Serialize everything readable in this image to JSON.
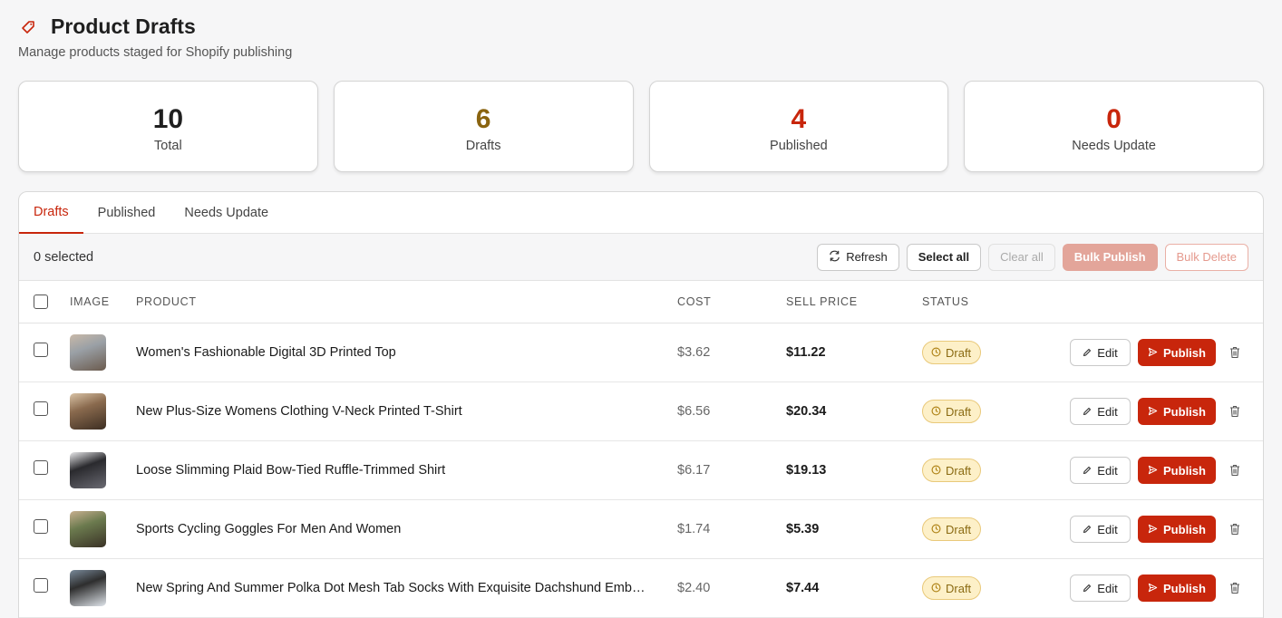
{
  "header": {
    "title": "Product Drafts",
    "subtitle": "Manage products staged for Shopify publishing",
    "icon": "tag-icon"
  },
  "stats": [
    {
      "value": "10",
      "label": "Total",
      "color": "#1f1f1f"
    },
    {
      "value": "6",
      "label": "Drafts",
      "color": "#8a6410"
    },
    {
      "value": "4",
      "label": "Published",
      "color": "#c8260c"
    },
    {
      "value": "0",
      "label": "Needs Update",
      "color": "#c8260c"
    }
  ],
  "tabs": [
    {
      "label": "Drafts",
      "active": true
    },
    {
      "label": "Published",
      "active": false
    },
    {
      "label": "Needs Update",
      "active": false
    }
  ],
  "toolbar": {
    "selected": "0 selected",
    "refresh": "Refresh",
    "select_all": "Select all",
    "clear_all": "Clear all",
    "bulk_publish": "Bulk Publish",
    "bulk_delete": "Bulk Delete"
  },
  "columns": {
    "image": "IMAGE",
    "product": "PRODUCT",
    "cost": "COST",
    "sell_price": "SELL PRICE",
    "status": "STATUS"
  },
  "rows": [
    {
      "name": "Women's Fashionable Digital 3D Printed Top",
      "cost": "$3.62",
      "price": "$11.22",
      "status": "Draft",
      "edit": "Edit",
      "publish": "Publish"
    },
    {
      "name": "New Plus-Size Womens Clothing V-Neck Printed T-Shirt",
      "cost": "$6.56",
      "price": "$20.34",
      "status": "Draft",
      "edit": "Edit",
      "publish": "Publish"
    },
    {
      "name": "Loose Slimming Plaid Bow-Tied Ruffle-Trimmed Shirt",
      "cost": "$6.17",
      "price": "$19.13",
      "status": "Draft",
      "edit": "Edit",
      "publish": "Publish"
    },
    {
      "name": "Sports Cycling Goggles For Men And Women",
      "cost": "$1.74",
      "price": "$5.39",
      "status": "Draft",
      "edit": "Edit",
      "publish": "Publish"
    },
    {
      "name": "New Spring And Summer Polka Dot Mesh Tab Socks With Exquisite Dachshund Emb…",
      "cost": "$2.40",
      "price": "$7.44",
      "status": "Draft",
      "edit": "Edit",
      "publish": "Publish"
    }
  ],
  "colors": {
    "accent": "#c8260c",
    "draft_badge_bg": "#fdf0c8",
    "draft_badge_text": "#8a6a12"
  }
}
